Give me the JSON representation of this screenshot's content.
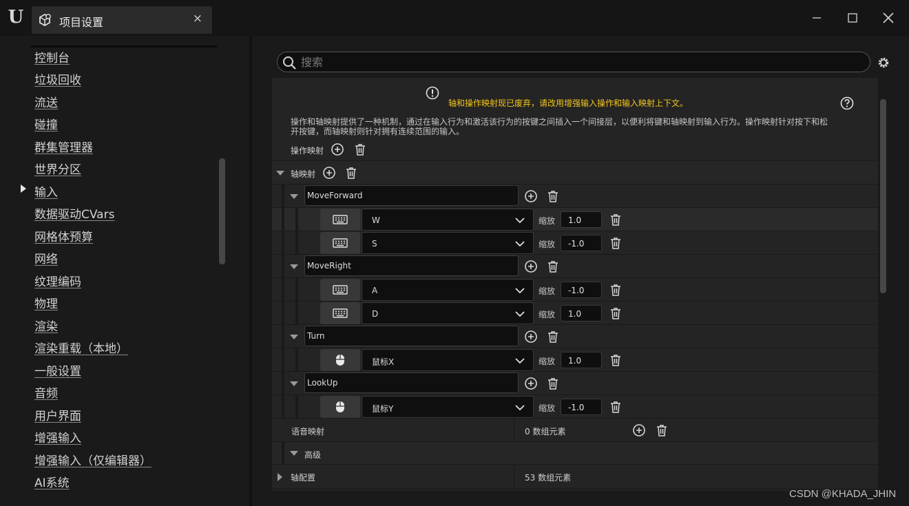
{
  "window": {
    "tab_title": "项目设置",
    "tab_close_glyph": "×",
    "logo_glyph": "U"
  },
  "sidebar": {
    "items": [
      {
        "label": "控制台"
      },
      {
        "label": "垃圾回收"
      },
      {
        "label": "流送"
      },
      {
        "label": "碰撞"
      },
      {
        "label": "群集管理器"
      },
      {
        "label": "世界分区"
      },
      {
        "label": "输入",
        "selected": true
      },
      {
        "label": "数据驱动CVars"
      },
      {
        "label": "网格体预算"
      },
      {
        "label": "网络"
      },
      {
        "label": "纹理编码"
      },
      {
        "label": "物理"
      },
      {
        "label": "渲染"
      },
      {
        "label": "渲染重载（本地）"
      },
      {
        "label": "一般设置"
      },
      {
        "label": "音频"
      },
      {
        "label": "用户界面"
      },
      {
        "label": "增强输入"
      },
      {
        "label": "增强输入（仅编辑器）"
      },
      {
        "label": "AI系统"
      }
    ]
  },
  "search": {
    "placeholder": "搜索",
    "value": ""
  },
  "panel": {
    "notice": "轴和操作映射现已废弃，请改用增强输入操作和输入映射上下文。",
    "description": "操作和轴映射提供了一种机制，通过在输入行为和激活该行为的按键之间插入一个间接层，以便利将键和轴映射到输入行为。操作映射针对按下和松开按键，而轴映射则针对拥有连续范围的输入。",
    "action_mappings_label": "操作映射",
    "axis_mappings_label": "轴映射",
    "scale_label": "缩放",
    "axis_mappings": [
      {
        "name": "MoveForward",
        "keys": [
          {
            "device": "keyboard-icon",
            "key": "W",
            "scale": "1.0"
          },
          {
            "device": "keyboard-icon",
            "key": "S",
            "scale": "-1.0"
          }
        ]
      },
      {
        "name": "MoveRight",
        "keys": [
          {
            "device": "keyboard-icon",
            "key": "A",
            "scale": "-1.0"
          },
          {
            "device": "keyboard-icon",
            "key": "D",
            "scale": "1.0"
          }
        ]
      },
      {
        "name": "Turn",
        "keys": [
          {
            "device": "mouse-icon",
            "key": "鼠标X",
            "scale": "1.0"
          }
        ]
      },
      {
        "name": "LookUp",
        "keys": [
          {
            "device": "mouse-icon",
            "key": "鼠标Y",
            "scale": "-1.0"
          }
        ]
      }
    ],
    "speech_mappings_label": "语音映射",
    "speech_mappings_value": "0 数组元素",
    "advanced_label": "高级",
    "axis_config_label": "轴配置",
    "axis_config_value": "53 数组元素"
  },
  "watermark": "CSDN @KHADA_JHIN",
  "colors": {
    "warning": "#f3c61a",
    "panel_bg": "#242424",
    "window_bg": "#151515"
  }
}
